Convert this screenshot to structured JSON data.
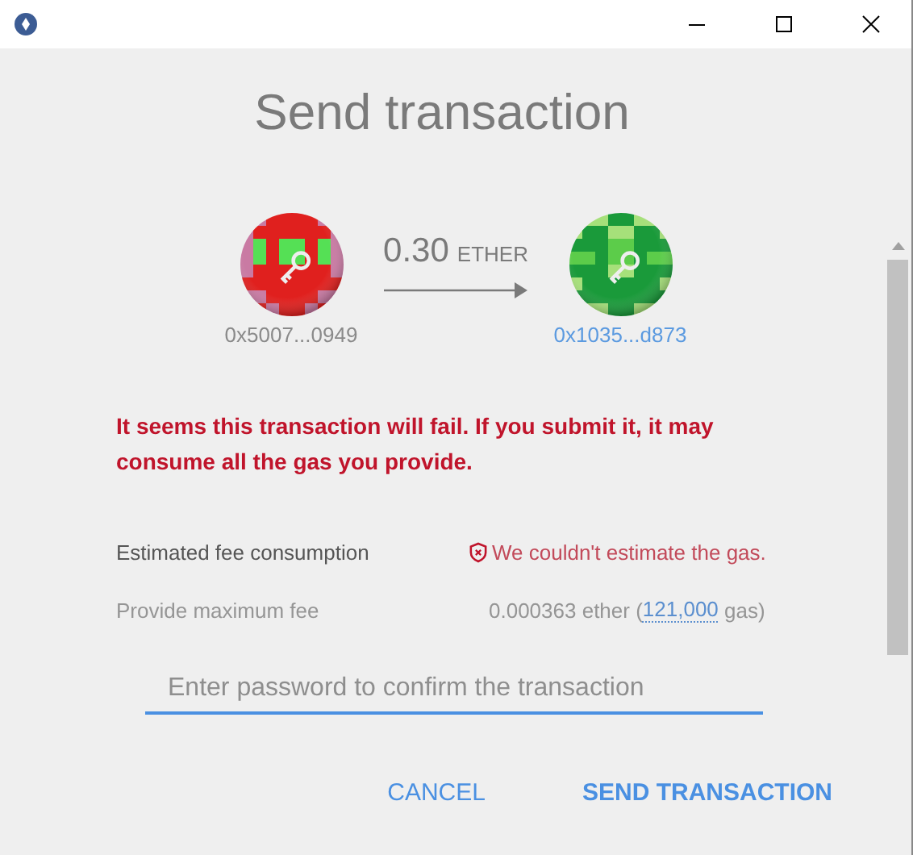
{
  "heading": "Send transaction",
  "transfer": {
    "amount": "0.30",
    "unit": "ETHER",
    "from": "0x5007...0949",
    "to": "0x1035...d873"
  },
  "warning": "It seems this transaction will fail. If you submit it, it may consume all the gas you provide.",
  "fee_rows": [
    {
      "kind": "error",
      "label": "Estimated fee consumption",
      "value": "We couldn't estimate the gas."
    },
    {
      "kind": "gas",
      "label": "Provide maximum fee",
      "value": "0.000363 ether (",
      "gas": "121,000",
      "unit": " gas)"
    }
  ],
  "password": {
    "placeholder": "Enter password to confirm the transaction"
  },
  "buttons": [
    {
      "kind": "secondary",
      "label": "CANCEL"
    },
    {
      "kind": "primary",
      "label": "SEND TRANSACTION"
    }
  ]
}
